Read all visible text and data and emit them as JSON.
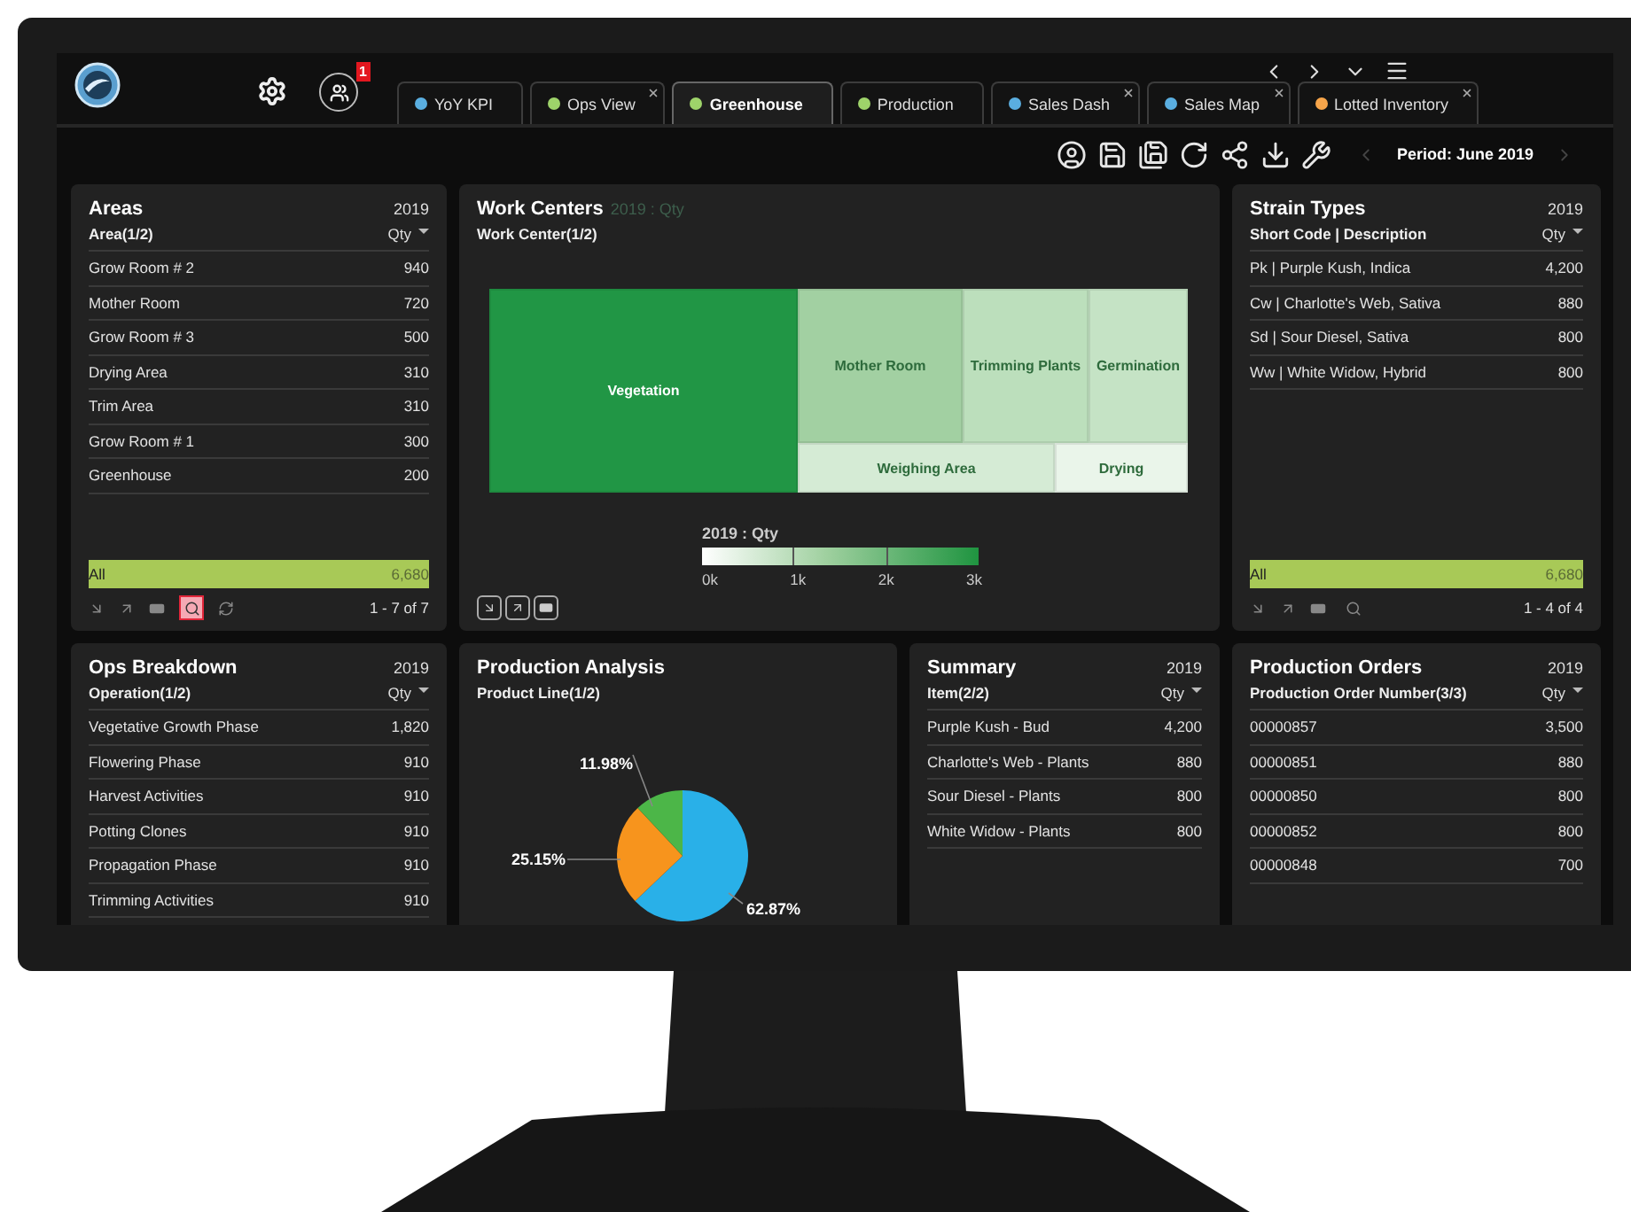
{
  "header": {
    "notifications": "1"
  },
  "tabs": [
    {
      "label": "YoY KPI",
      "color": "#5aaee0",
      "selected": false,
      "closable": false
    },
    {
      "label": "Ops View",
      "color": "#9ed36a",
      "selected": false,
      "closable": true
    },
    {
      "label": "Greenhouse",
      "color": "#9ed36a",
      "selected": true,
      "closable": false
    },
    {
      "label": "Production",
      "color": "#9ed36a",
      "selected": false,
      "closable": false
    },
    {
      "label": "Sales Dash",
      "color": "#5aaee0",
      "selected": false,
      "closable": true
    },
    {
      "label": "Sales Map",
      "color": "#5aaee0",
      "selected": false,
      "closable": true
    },
    {
      "label": "Lotted Inventory",
      "color": "#f7a54a",
      "selected": false,
      "closable": true
    }
  ],
  "toolbar": {
    "period": "Period: June 2019"
  },
  "panels_top": [
    {
      "kind": "list",
      "title": "Areas",
      "year": "2019",
      "column": "Area(1/2)",
      "measure": "Qty",
      "rows": [
        {
          "label": "Grow Room # 2",
          "value": "940"
        },
        {
          "label": "Mother Room",
          "value": "720"
        },
        {
          "label": "Grow Room # 3",
          "value": "500"
        },
        {
          "label": "Drying Area",
          "value": "310"
        },
        {
          "label": "Trim Area",
          "value": "310"
        },
        {
          "label": "Grow Room # 1",
          "value": "300"
        },
        {
          "label": "Greenhouse",
          "value": "200"
        }
      ],
      "total": {
        "label": "All",
        "value": "6,680"
      },
      "pager": "1 - 7 of 7",
      "search_active": true,
      "refresh_tool": true
    },
    {
      "kind": "treemap",
      "title": "Work Centers",
      "measure_note": "2019 : Qty",
      "column": "Work Center(1/2)",
      "tiles": [
        {
          "label": "Vegetation",
          "color": "#219645"
        },
        {
          "label": "Mother Room",
          "color": "#a2d0a2"
        },
        {
          "label": "Trimming Plants",
          "color": "#bcdfbc"
        },
        {
          "label": "Germination",
          "color": "#c5e3c5"
        },
        {
          "label": "Weighing Area",
          "color": "#d5ebd5"
        },
        {
          "label": "Drying",
          "color": "#eaf5ea"
        }
      ],
      "legend": {
        "title": "2019 : Qty",
        "ticks": [
          "0k",
          "1k",
          "2k",
          "3k"
        ]
      }
    },
    {
      "kind": "list",
      "title": "Strain Types",
      "year": "2019",
      "column": "Short Code | Description",
      "measure": "Qty",
      "rows": [
        {
          "label": "Pk | Purple Kush, Indica",
          "value": "4,200"
        },
        {
          "label": "Cw | Charlotte's Web, Sativa",
          "value": "880"
        },
        {
          "label": "Sd | Sour Diesel, Sativa",
          "value": "800"
        },
        {
          "label": "Ww | White Widow, Hybrid",
          "value": "800"
        }
      ],
      "total": {
        "label": "All",
        "value": "6,680"
      },
      "pager": "1 - 4 of 4",
      "search_active": false,
      "refresh_tool": false
    }
  ],
  "panels_bottom": [
    {
      "kind": "list",
      "title": "Ops Breakdown",
      "year": "2019",
      "column": "Operation(1/2)",
      "measure": "Qty",
      "rows": [
        {
          "label": "Vegetative Growth Phase",
          "value": "1,820"
        },
        {
          "label": "Flowering Phase",
          "value": "910"
        },
        {
          "label": "Harvest Activities",
          "value": "910"
        },
        {
          "label": "Potting Clones",
          "value": "910"
        },
        {
          "label": "Propagation Phase",
          "value": "910"
        },
        {
          "label": "Trimming Activities",
          "value": "910"
        }
      ]
    },
    {
      "kind": "pie",
      "title": "Production Analysis",
      "column": "Product Line(1/2)",
      "chart_data": {
        "type": "pie",
        "values": [
          62.87,
          25.15,
          11.98
        ],
        "colors": [
          "#29b0e8",
          "#f7941d",
          "#4cb648"
        ],
        "value_labels": [
          "62.87%",
          "25.15%",
          "11.98%"
        ]
      }
    },
    {
      "kind": "list",
      "title": "Summary",
      "year": "2019",
      "column": "Item(2/2)",
      "measure": "Qty",
      "rows": [
        {
          "label": "Purple Kush - Bud",
          "value": "4,200"
        },
        {
          "label": "Charlotte's Web - Plants",
          "value": "880"
        },
        {
          "label": "Sour Diesel - Plants",
          "value": "800"
        },
        {
          "label": "White Widow - Plants",
          "value": "800"
        }
      ]
    },
    {
      "kind": "list",
      "title": "Production Orders",
      "year": "2019",
      "column": "Production Order Number(3/3)",
      "measure": "Qty",
      "rows": [
        {
          "label": "00000857",
          "value": "3,500"
        },
        {
          "label": "00000851",
          "value": "880"
        },
        {
          "label": "00000850",
          "value": "800"
        },
        {
          "label": "00000852",
          "value": "800"
        },
        {
          "label": "00000848",
          "value": "700"
        }
      ]
    }
  ]
}
